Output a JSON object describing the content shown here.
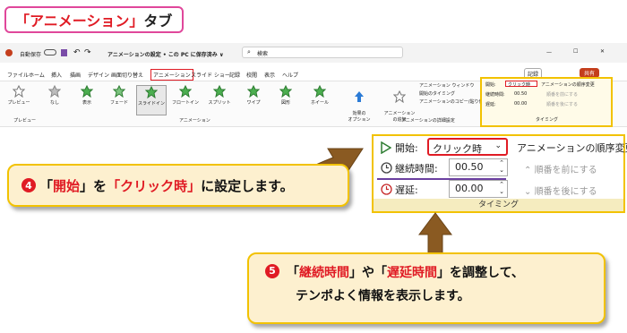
{
  "title_badge": {
    "bracket_open": "「",
    "name": "アニメーション",
    "bracket_close": "」",
    "suffix": "タブ"
  },
  "window": {
    "autosave_label": "自動保存",
    "toggle_state": "オフ",
    "doc_title": "アニメーションの設定 • この PC に保存済み ∨",
    "search_placeholder": "検索",
    "record_button": "記録",
    "share_button": "共有"
  },
  "tabs": [
    "ファイル",
    "ホーム",
    "挿入",
    "描画",
    "デザイン",
    "画面切り替え",
    "アニメーション",
    "スライド ショー",
    "記録",
    "校閲",
    "表示",
    "ヘルプ"
  ],
  "active_tab": "アニメーション",
  "ribbon": {
    "preview": "プレビュー",
    "preview_group": "プレビュー",
    "animation_group": "アニメーション",
    "effects": [
      "なし",
      "表示",
      "フェード",
      "スライドイン",
      "フロートイン",
      "スプリット",
      "ワイプ",
      "図形",
      "ホイール"
    ],
    "effect_options": "効果の\nオプション",
    "add_animation": "アニメーション\nの追加",
    "animation_window": "アニメーション ウィンドウ",
    "trigger": "開始のタイミング",
    "animation_painter": "アニメーションのコピー/貼り付け",
    "advanced_group": "アニメーションの詳細設定"
  },
  "timing_panel": {
    "start_label": "開始:",
    "start_value": "クリック時",
    "duration_label": "継続時間:",
    "duration_value": "00.50",
    "delay_label": "遅延:",
    "delay_value": "00.00",
    "reorder_title": "アニメーションの順序変更",
    "move_earlier": "順番を前にする",
    "move_later": "順番を後にする",
    "group_label": "タイミング"
  },
  "callout4": {
    "number": "4",
    "q1": "「",
    "k1": "開始",
    "q2": "」",
    "mid": "を",
    "q3": "「",
    "k2": "クリック時",
    "q4": "」",
    "end": "に設定します。"
  },
  "callout5": {
    "number": "5",
    "q1": "「",
    "k1": "継続時間",
    "q2": "」",
    "mid": "や",
    "q3": "「",
    "k2": "遅延時間",
    "q4": "」",
    "end1": "を調整して、",
    "line2": "テンポよく情報を表示します。"
  },
  "colors": {
    "accent_red": "#e01b24",
    "highlight_yellow": "#f2c200",
    "pink_border": "#e0479b",
    "underline_purple": "#6b3fa0",
    "arrow_brown": "#8a5a22"
  }
}
